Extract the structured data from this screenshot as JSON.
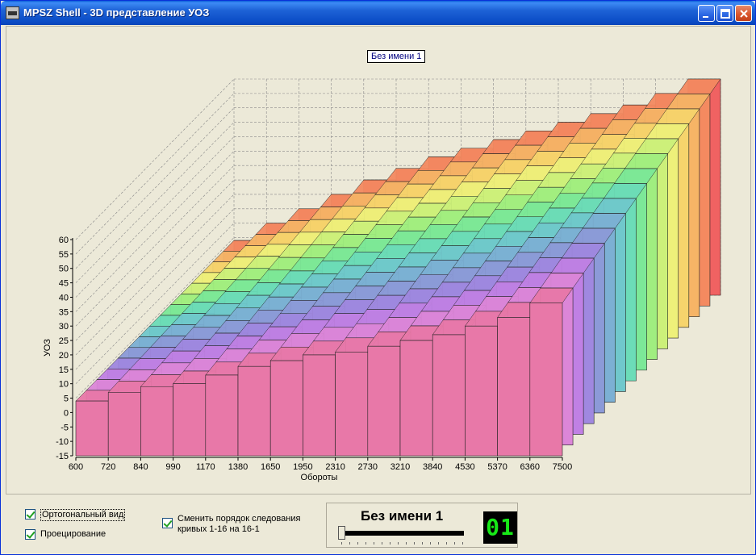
{
  "window": {
    "title": "MPSZ Shell - 3D представление УОЗ",
    "icon": "mpsz-app-icon",
    "controls": [
      "minimize-icon",
      "maximize-icon",
      "close-icon"
    ]
  },
  "chart": {
    "legend_label": "Без имени 1"
  },
  "chart_data": {
    "type": "surface-3d",
    "xlabel": "Обороты",
    "ylabel": "УОЗ",
    "x_ticks": [
      "600",
      "720",
      "840",
      "990",
      "1170",
      "1380",
      "1650",
      "1950",
      "2310",
      "2730",
      "3210",
      "3840",
      "4530",
      "5370",
      "6360",
      "7500"
    ],
    "y_ticks": [
      "60",
      "55",
      "50",
      "45",
      "40",
      "35",
      "30",
      "25",
      "20",
      "15",
      "10",
      "5",
      "0",
      "-5",
      "-10",
      "-15"
    ],
    "ylim": [
      -15,
      60
    ],
    "curves": 16,
    "grid": true,
    "front_curve_values": [
      4,
      7,
      9,
      10,
      13,
      16,
      18,
      20,
      21,
      23,
      25,
      27,
      30,
      33,
      38,
      38
    ],
    "back_curve_values": [
      4,
      10,
      15,
      20,
      25,
      29,
      33,
      36,
      39,
      42,
      45,
      48,
      51,
      55,
      60,
      60
    ]
  },
  "controls": {
    "ortho_label": "Ортогональный вид",
    "projection_label": "Проецирование",
    "swap_label_line1": "Сменить порядок следования",
    "swap_label_line2": "кривых 1-16 на 16-1",
    "panel_title": "Без имени 1",
    "digit_display": "01"
  }
}
